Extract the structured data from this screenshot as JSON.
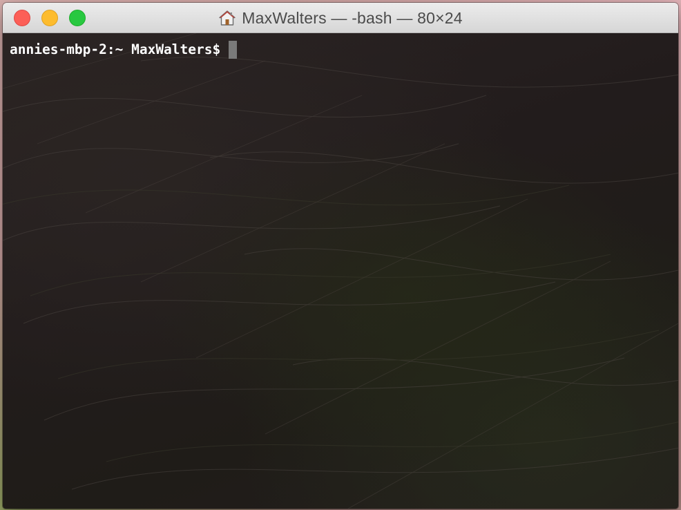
{
  "window": {
    "title": "MaxWalters — -bash — 80×24",
    "title_icon": "home-folder-icon",
    "buttons": {
      "close": "close-button",
      "minimize": "minimize-button",
      "zoom": "zoom-button"
    }
  },
  "terminal": {
    "prompt": "annies-mbp-2:~ MaxWalters$",
    "input": ""
  },
  "colors": {
    "close": "#fc5f57",
    "minimize": "#fdbc2e",
    "zoom": "#28c840",
    "prompt_text": "#ffffff",
    "cursor": "#7a7a7a"
  }
}
